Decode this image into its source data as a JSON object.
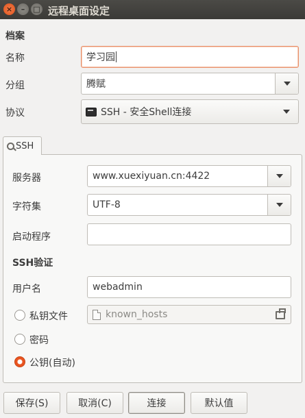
{
  "window": {
    "title": "远程桌面设定",
    "controls": {
      "close": "×",
      "minimize": "–",
      "maximize": "□"
    }
  },
  "profile": {
    "section_title": "档案",
    "name_label": "名称",
    "name_value": "学习园",
    "group_label": "分组",
    "group_value": "腾赋",
    "protocol_label": "协议",
    "protocol_value": "SSH - 安全Shell连接",
    "protocol_icon": "terminal-icon"
  },
  "tabs": [
    {
      "label": "SSH",
      "icon": "key-icon"
    }
  ],
  "ssh": {
    "server_label": "服务器",
    "server_value": "www.xuexiyuan.cn:4422",
    "charset_label": "字符集",
    "charset_value": "UTF-8",
    "startup_label": "启动程序",
    "startup_value": "",
    "auth_title": "SSH验证",
    "username_label": "用户名",
    "username_value": "webadmin",
    "auth_options": [
      {
        "label": "私钥文件",
        "checked": false
      },
      {
        "label": "密码",
        "checked": false
      },
      {
        "label": "公钥(自动)",
        "checked": true
      }
    ],
    "keyfile_value": "known_hosts"
  },
  "buttons": {
    "save": "保存(S)",
    "cancel": "取消(C)",
    "connect": "连接",
    "default": "默认值"
  },
  "colors": {
    "accent": "#e95420",
    "titlebar": "#3c3b37",
    "focus_border": "#e9906a"
  }
}
